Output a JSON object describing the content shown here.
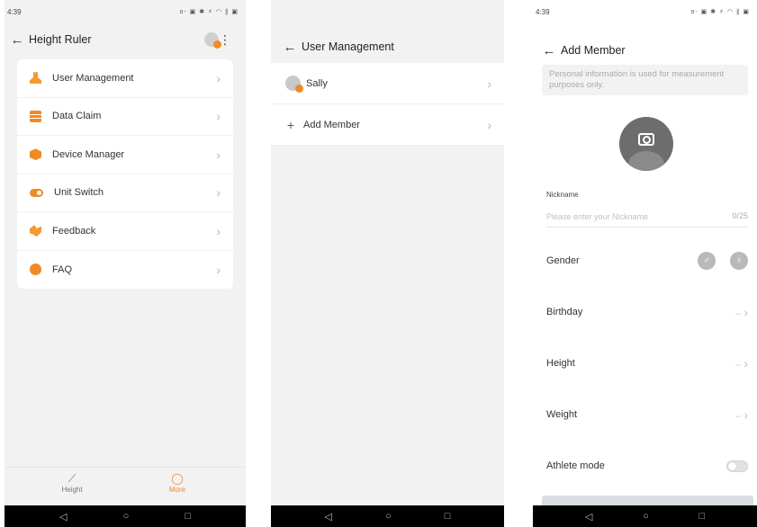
{
  "screen1": {
    "status_time": "4:39",
    "status_icons": "o- ▣ ✱ ⚡ ◠ ∥ ▣",
    "title": "Height Ruler",
    "menu": [
      {
        "label": "User Management",
        "icon": "user-icon"
      },
      {
        "label": "Data Claim",
        "icon": "data-icon"
      },
      {
        "label": "Device Manager",
        "icon": "device-icon"
      },
      {
        "label": "Unit Switch",
        "icon": "toggle-icon"
      },
      {
        "label": "Feedback",
        "icon": "handshake-icon"
      },
      {
        "label": "FAQ",
        "icon": "faq-icon"
      }
    ],
    "tabs": [
      {
        "label": "Height",
        "icon": "ruler-icon"
      },
      {
        "label": "More",
        "icon": "more-icon"
      }
    ]
  },
  "screen2": {
    "title": "User Management",
    "rows": [
      {
        "label": "Sally"
      },
      {
        "label": "Add Member"
      }
    ]
  },
  "screen3": {
    "status_time": "4:39",
    "status_icons": "o- ▣ ✱ ⚡ ◠ ∥ ▣",
    "title": "Add Member",
    "notice": "Personal information is used for measurement purposes only.",
    "nickname_label": "Nickname",
    "nickname_placeholder": "Please enter your Nickname",
    "nickname_count": "0/25",
    "gender_label": "Gender",
    "birthday_label": "Birthday",
    "birthday_value": "--",
    "height_label": "Height",
    "height_value": "--",
    "weight_label": "Weight",
    "weight_value": "--",
    "athlete_label": "Athlete mode"
  },
  "colors": {
    "accent": "#f08a24",
    "background": "#f2f2f2"
  }
}
